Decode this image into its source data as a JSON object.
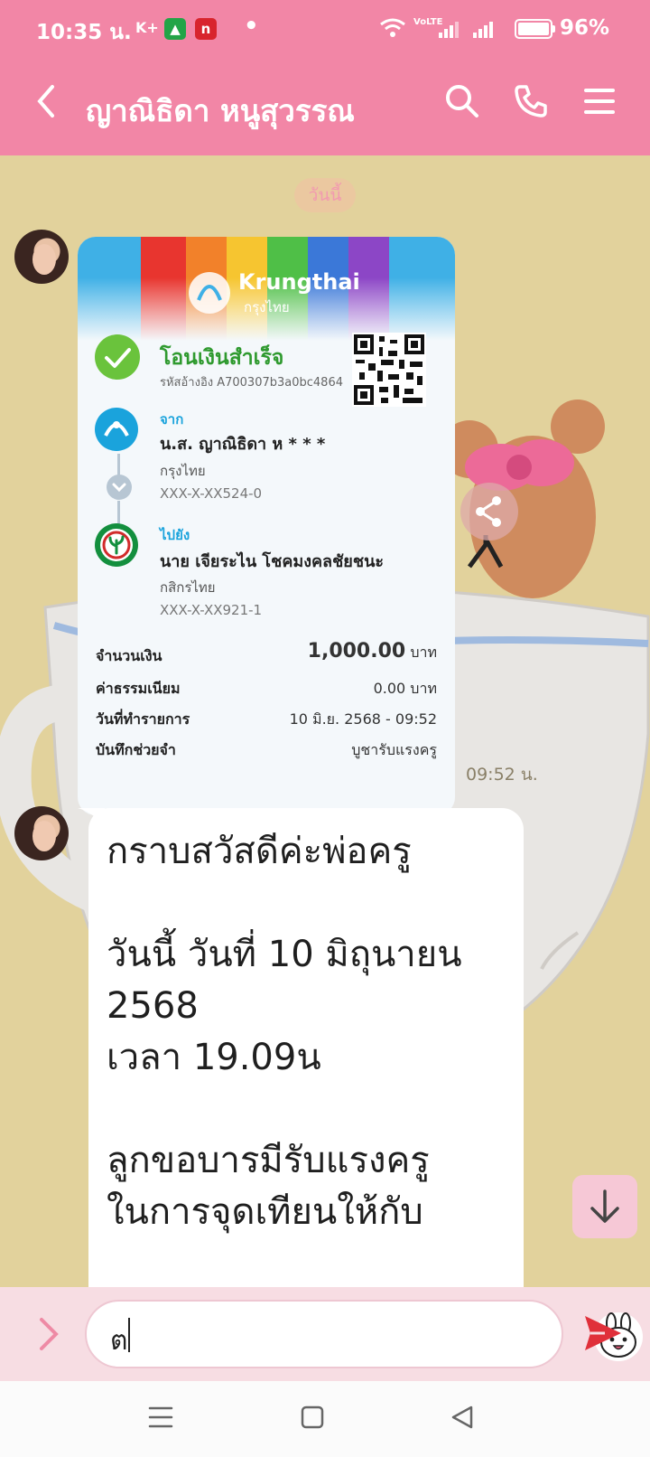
{
  "status_bar": {
    "time": "10:35 น.",
    "carrier_label": "K+",
    "volte_label": "VoLTE",
    "battery": "96%",
    "battery_level": 0.96
  },
  "header": {
    "contact_name": "ญาณิธิดา หนูสุวรรณ",
    "back_icon": "chevron-left-icon",
    "search_icon": "search-icon",
    "call_icon": "phone-icon",
    "menu_icon": "hamburger-menu-icon"
  },
  "chat": {
    "date_pill": "วันนี้",
    "transfer_slip": {
      "bank_name": "Krungthai",
      "bank_name_th": "กรุงไทย",
      "status": "โอนเงินสำเร็จ",
      "reference": "รหัสอ้างอิง A700307b3a0bc4864",
      "from_label": "จาก",
      "from_name": "น.ส. ญาณิธิดา ห * * *",
      "from_bank": "กรุงไทย",
      "from_account": "XXX-X-XX524-0",
      "to_label": "ไปยัง",
      "to_name": "นาย เจียระไน โชคมงคลชัยชนะ",
      "to_bank": "กสิกรไทย",
      "to_account": "XXX-X-XX921-1",
      "amount_label": "จำนวนเงิน",
      "amount": "1,000.00",
      "currency": "บาท",
      "fee_label": "ค่าธรรมเนียม",
      "fee": "0.00 บาท",
      "datetime_label": "วันที่ทำรายการ",
      "datetime": "10 มิ.ย. 2568 - 09:52",
      "memo_label": "บันทึกช่วยจำ",
      "memo": "บูชารับแรงครู"
    },
    "slip_time": "09:52 น.",
    "message_text": "กราบสวัสดีค่ะพ่อครู\n\nวันนี้ วันที่ 10 มิถุนายน 2568\nเวลา 19.09น\n\nลูกขอบารมีรับแรงครู\nในการจุดเทียนให้กับ"
  },
  "input_bar": {
    "draft_text": "ต",
    "sticker_icon": "sticker-icon",
    "send_icon": "send-icon",
    "expand_icon": "chevron-right-icon"
  },
  "nav_bar": {
    "recents_icon": "recents-icon",
    "home_icon": "home-icon",
    "back_icon": "nav-back-icon"
  },
  "colors": {
    "header_pink": "#f286a6",
    "chat_bg": "#e2d29c",
    "input_bar_bg": "#f7dde3",
    "send_red": "#e0303a",
    "success_green": "#2f9a2f",
    "krungthai_blue": "#1aa3dc"
  }
}
